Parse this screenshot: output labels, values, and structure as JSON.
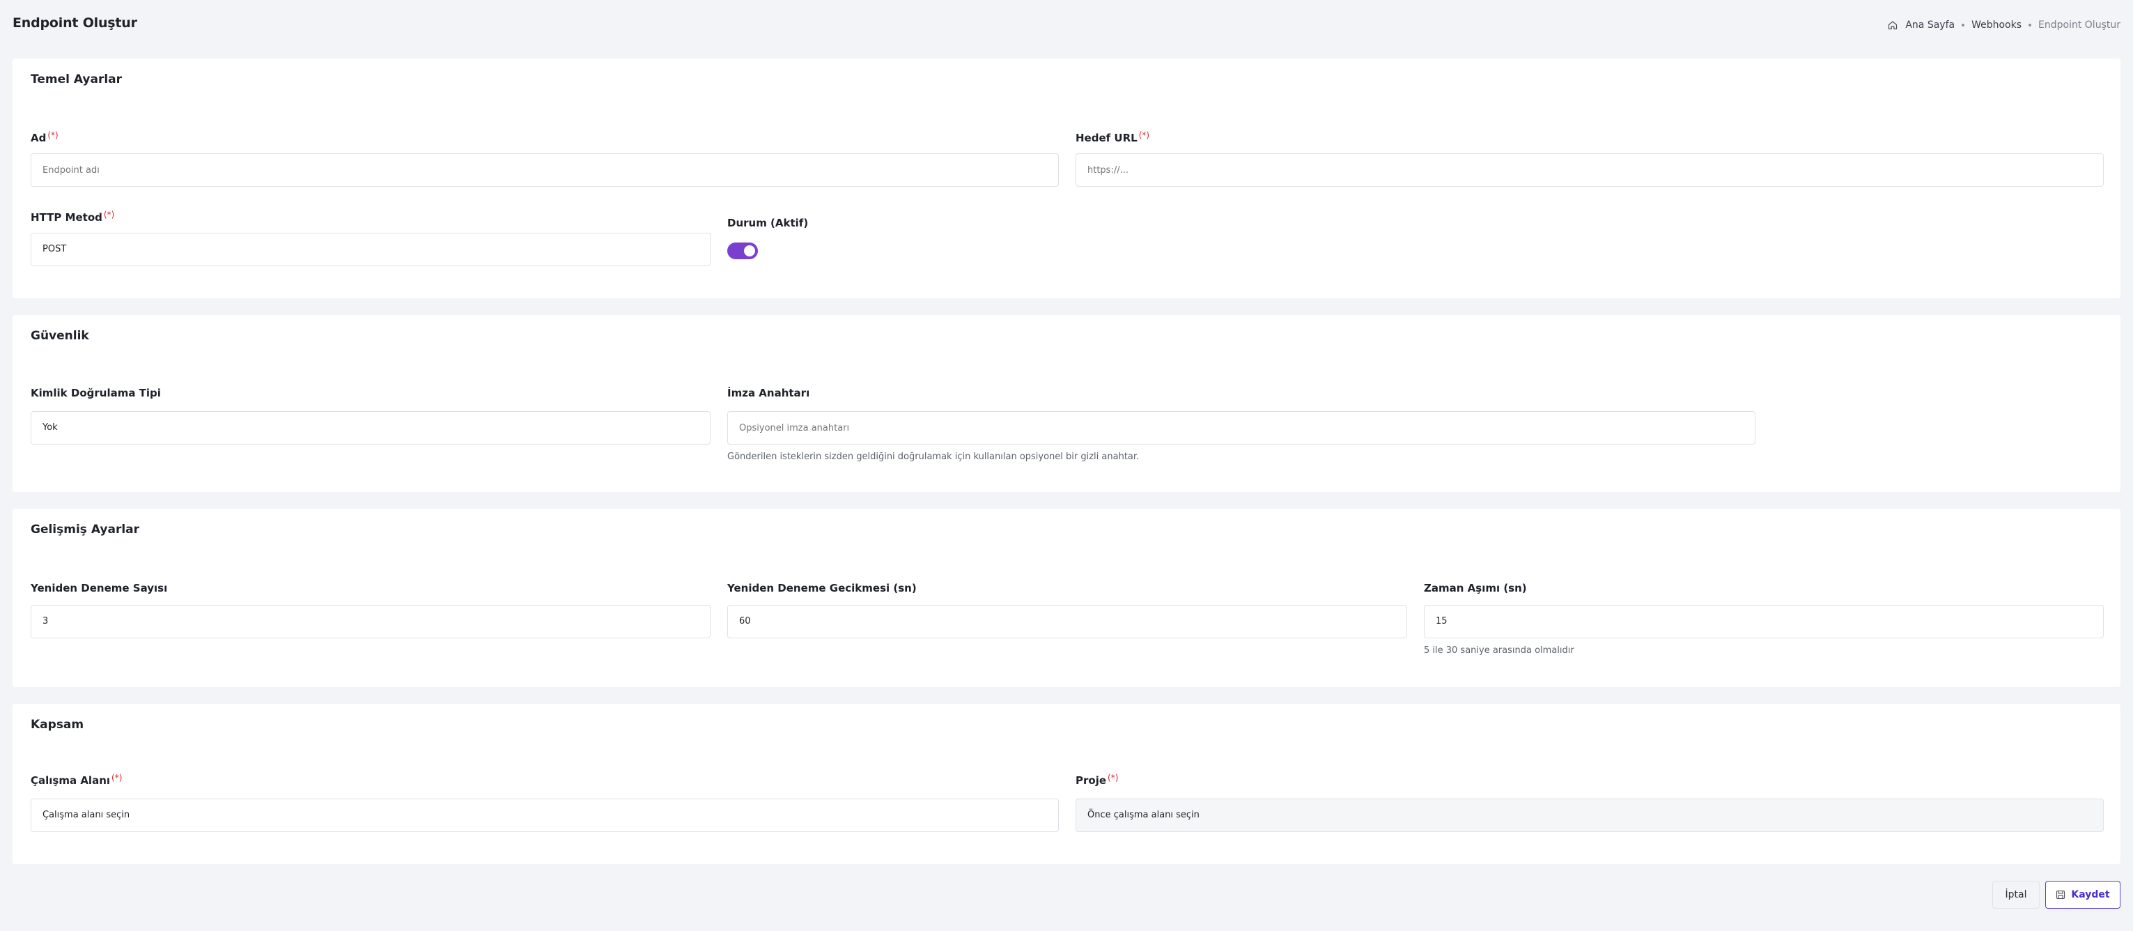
{
  "header": {
    "title": "Endpoint Oluştur",
    "breadcrumb": {
      "home": "Ana Sayfa",
      "section": "Webhooks",
      "current": "Endpoint Oluştur"
    }
  },
  "basic": {
    "title": "Temel Ayarlar",
    "name": {
      "label": "Ad",
      "required": "(*)",
      "placeholder": "Endpoint adı"
    },
    "url": {
      "label": "Hedef URL",
      "required": "(*)",
      "placeholder": "https://..."
    },
    "method": {
      "label": "HTTP Metod",
      "required": "(*)",
      "value": "POST"
    },
    "status": {
      "label": "Durum (Aktif)",
      "enabled": true
    }
  },
  "security": {
    "title": "Güvenlik",
    "auth_type": {
      "label": "Kimlik Doğrulama Tipi",
      "value": "Yok"
    },
    "signing_key": {
      "label": "İmza Anahtarı",
      "placeholder": "Opsiyonel imza anahtarı",
      "help": "Gönderilen isteklerin sizden geldiğini doğrulamak için kullanılan opsiyonel bir gizli anahtar."
    }
  },
  "advanced": {
    "title": "Gelişmiş Ayarlar",
    "retry_count": {
      "label": "Yeniden Deneme Sayısı",
      "value": "3"
    },
    "retry_delay": {
      "label": "Yeniden Deneme Gecikmesi (sn)",
      "value": "60"
    },
    "timeout": {
      "label": "Zaman Aşımı (sn)",
      "value": "15",
      "help": "5 ile 30 saniye arasında olmalıdır"
    }
  },
  "scope": {
    "title": "Kapsam",
    "workspace": {
      "label": "Çalışma Alanı",
      "required": "(*)",
      "value": "Çalışma alanı seçin"
    },
    "project": {
      "label": "Proje",
      "required": "(*)",
      "value": "Önce çalışma alanı seçin"
    }
  },
  "actions": {
    "cancel": "İptal",
    "save": "Kaydet"
  },
  "colors": {
    "accent": "#7b3fd0",
    "save_border": "#5a3fd0",
    "required": "#e0262f"
  },
  "icons": {
    "home": "home-icon",
    "save": "save-icon"
  }
}
